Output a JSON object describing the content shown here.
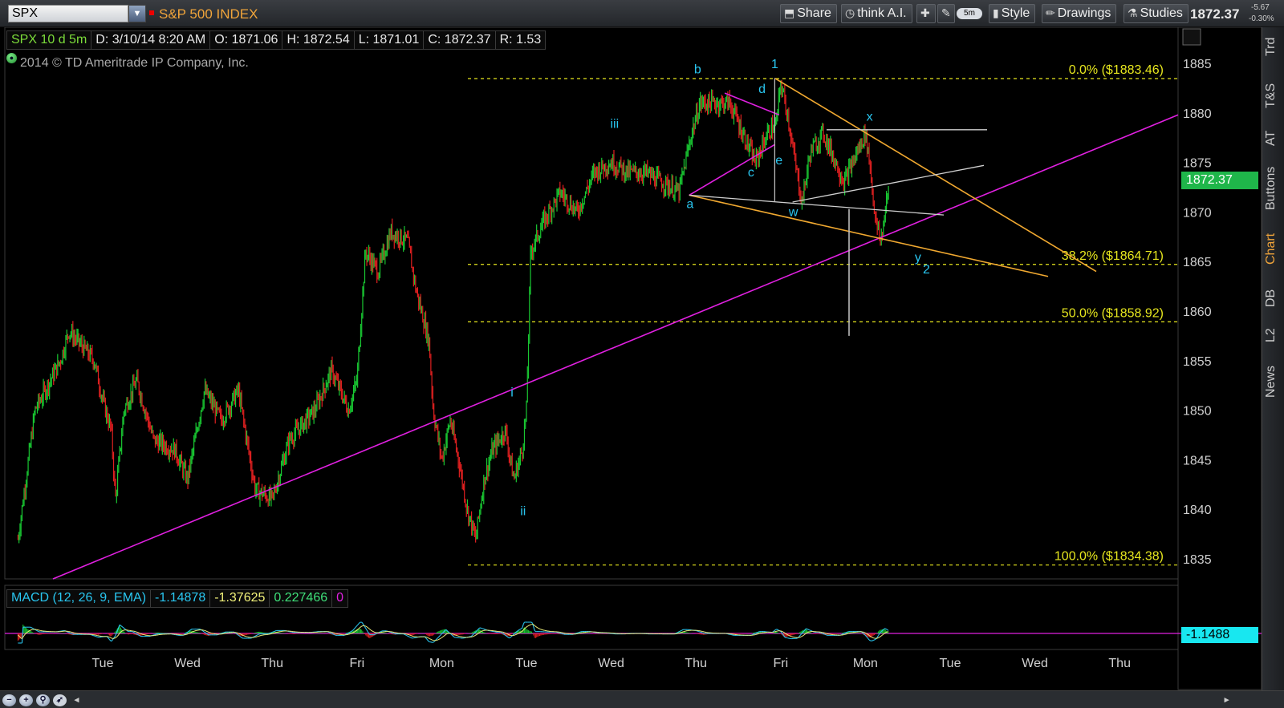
{
  "toolbar": {
    "symbol": "SPX",
    "title": "S&P 500 INDEX",
    "share_label": "Share",
    "thinkai_label": "think A.I.",
    "interval_label": "5m",
    "style_label": "Style",
    "drawings_label": "Drawings",
    "studies_label": "Studies",
    "last_price": "1872.37",
    "change_abs": "-5.67",
    "change_pct": "-0.30%"
  },
  "info": {
    "symbol_period": "SPX 10 d 5m",
    "date": "D: 3/10/14 8:20 AM",
    "open": "O: 1871.06",
    "high": "H: 1872.54",
    "low": "L: 1871.01",
    "close": "C: 1872.37",
    "range": "R: 1.53",
    "copyright": "2014 © TD Ameritrade IP Company, Inc."
  },
  "macd": {
    "label": "MACD (12, 26, 9, EMA)",
    "value": "-1.14878",
    "avg": "-1.37625",
    "diff": "0.227466",
    "zero": "0",
    "price_box": "-1.1488"
  },
  "right_tabs": [
    "Trd",
    "T&S",
    "AT",
    "Buttons",
    "Chart",
    "DB",
    "L2",
    "News"
  ],
  "colors": {
    "up": "#19c832",
    "down": "#e02020",
    "fib": "#e6e61e",
    "magenta": "#e020e0",
    "orange": "#f0a830",
    "cyan": "#29c6f0"
  },
  "chart_data": {
    "type": "candlestick",
    "title": "S&P 500 INDEX",
    "interval": "5m",
    "ylim": [
      1832,
      1887
    ],
    "yticks": [
      1835,
      1840,
      1845,
      1850,
      1855,
      1860,
      1865,
      1870,
      1875,
      1880,
      1885
    ],
    "xlabels": [
      "Tue",
      "Wed",
      "Thu",
      "Fri",
      "Mon",
      "Tue",
      "Wed",
      "Thu",
      "Fri",
      "Mon",
      "Tue",
      "Wed",
      "Thu"
    ],
    "fib_levels": [
      {
        "label": "0.0%",
        "value": 1883.46,
        "text": "($1883.46)"
      },
      {
        "label": "38.2%",
        "value": 1864.71,
        "text": "($1864.71)"
      },
      {
        "label": "50.0%",
        "value": 1858.92,
        "text": "($1858.92)"
      },
      {
        "label": "100.0%",
        "value": 1834.38,
        "text": "($1834.38)"
      }
    ],
    "price_path": [
      [
        0,
        1837
      ],
      [
        0.2,
        1850
      ],
      [
        0.5,
        1855
      ],
      [
        0.6,
        1858
      ],
      [
        0.9,
        1855
      ],
      [
        1.0,
        1851
      ],
      [
        1.1,
        1848
      ],
      [
        1.15,
        1841
      ],
      [
        1.25,
        1850
      ],
      [
        1.4,
        1853
      ],
      [
        1.6,
        1847
      ],
      [
        1.85,
        1846
      ],
      [
        2.0,
        1843
      ],
      [
        2.2,
        1852
      ],
      [
        2.4,
        1849
      ],
      [
        2.6,
        1852
      ],
      [
        2.8,
        1842
      ],
      [
        3.0,
        1841
      ],
      [
        3.2,
        1847
      ],
      [
        3.5,
        1850
      ],
      [
        3.7,
        1854
      ],
      [
        3.9,
        1850
      ],
      [
        4.0,
        1853
      ],
      [
        4.1,
        1866
      ],
      [
        4.25,
        1864
      ],
      [
        4.4,
        1868
      ],
      [
        4.6,
        1867
      ],
      [
        4.7,
        1862
      ],
      [
        4.85,
        1857
      ],
      [
        4.9,
        1850
      ],
      [
        5.0,
        1845
      ],
      [
        5.1,
        1849
      ],
      [
        5.2,
        1845
      ],
      [
        5.3,
        1840
      ],
      [
        5.4,
        1837
      ],
      [
        5.5,
        1843
      ],
      [
        5.6,
        1846
      ],
      [
        5.75,
        1848
      ],
      [
        5.85,
        1843
      ],
      [
        5.95,
        1846
      ],
      [
        6.0,
        1850
      ],
      [
        6.05,
        1866
      ],
      [
        6.2,
        1869
      ],
      [
        6.4,
        1872
      ],
      [
        6.6,
        1870
      ],
      [
        6.8,
        1874
      ],
      [
        7.0,
        1875
      ],
      [
        7.2,
        1874
      ],
      [
        7.4,
        1874
      ],
      [
        7.6,
        1873
      ],
      [
        7.8,
        1872
      ],
      [
        7.95,
        1878
      ],
      [
        8.05,
        1881
      ],
      [
        8.2,
        1881
      ],
      [
        8.4,
        1881
      ],
      [
        8.55,
        1878
      ],
      [
        8.7,
        1875
      ],
      [
        8.85,
        1878
      ],
      [
        8.95,
        1879
      ],
      [
        9.0,
        1883
      ],
      [
        9.08,
        1880
      ],
      [
        9.15,
        1876
      ],
      [
        9.25,
        1871
      ],
      [
        9.35,
        1876
      ],
      [
        9.5,
        1878
      ],
      [
        9.6,
        1876
      ],
      [
        9.75,
        1873
      ],
      [
        9.85,
        1875
      ],
      [
        9.95,
        1877
      ],
      [
        10.0,
        1878
      ],
      [
        10.05,
        1875
      ],
      [
        10.12,
        1869
      ],
      [
        10.18,
        1867
      ],
      [
        10.25,
        1871
      ],
      [
        10.28,
        1872.4
      ]
    ],
    "wave_labels": [
      {
        "text": "b",
        "x": 8.02,
        "y": 1884.0
      },
      {
        "text": "1",
        "x": 8.93,
        "y": 1884.5
      },
      {
        "text": "d",
        "x": 8.78,
        "y": 1882.0
      },
      {
        "text": "iii",
        "x": 7.04,
        "y": 1878.5
      },
      {
        "text": "x",
        "x": 10.05,
        "y": 1879.2
      },
      {
        "text": "c",
        "x": 8.65,
        "y": 1873.6
      },
      {
        "text": "e",
        "x": 8.98,
        "y": 1874.8
      },
      {
        "text": "a",
        "x": 7.93,
        "y": 1870.4
      },
      {
        "text": "w",
        "x": 9.15,
        "y": 1869.6
      },
      {
        "text": "y",
        "x": 10.62,
        "y": 1865.0
      },
      {
        "text": "2",
        "x": 10.72,
        "y": 1863.8
      },
      {
        "text": "i",
        "x": 5.83,
        "y": 1851.4
      },
      {
        "text": "ii",
        "x": 5.96,
        "y": 1839.4
      }
    ]
  }
}
